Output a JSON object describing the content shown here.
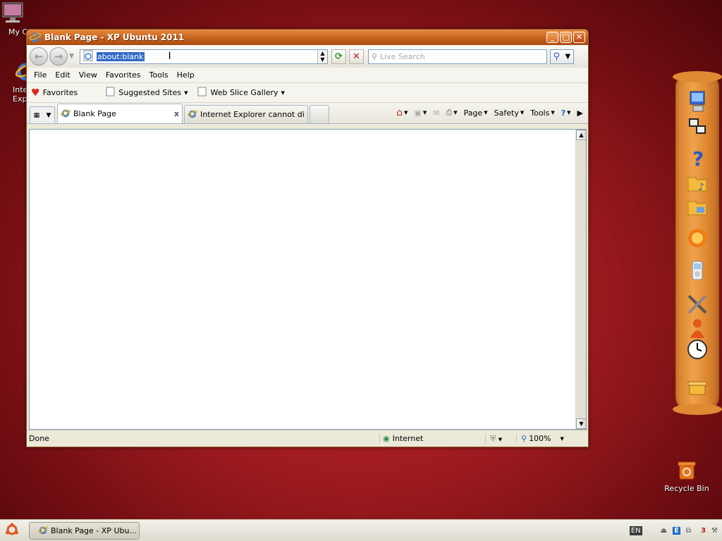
{
  "desktop": {
    "icons": [
      {
        "label": "My Co"
      },
      {
        "label": "Inte\nExp"
      },
      {
        "label": "Recycle Bin"
      }
    ]
  },
  "window": {
    "title": "Blank Page - XP Ubuntu 2011",
    "address": "about:blank",
    "search_placeholder": "Live Search",
    "menu": [
      "File",
      "Edit",
      "View",
      "Favorites",
      "Tools",
      "Help"
    ],
    "favorites_label": "Favorites",
    "fav_links": [
      "Suggested Sites",
      "Web Slice Gallery"
    ],
    "tabs": [
      {
        "label": "Blank Page",
        "active": true
      },
      {
        "label": "Internet Explorer cannot dis...",
        "active": false
      }
    ],
    "commands": [
      "Page",
      "Safety",
      "Tools"
    ],
    "status": {
      "text": "Done",
      "zone": "Internet",
      "zoom": "100%"
    }
  },
  "taskbar": {
    "task_label": "Blank Page - XP Ubu...",
    "lang": "EN"
  },
  "colors": {
    "accent": "#c35f1a",
    "selection": "#316ac5",
    "desktop": "#9c1a1f"
  }
}
